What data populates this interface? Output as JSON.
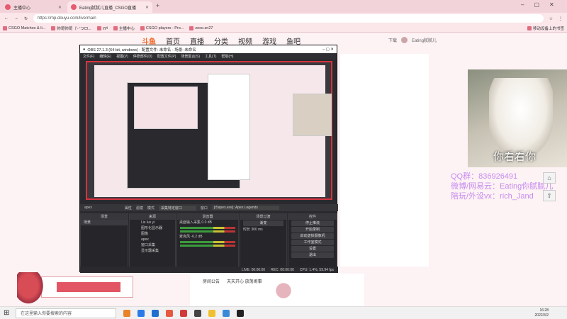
{
  "browser": {
    "tabs": [
      {
        "label": "主播中心"
      },
      {
        "label": "Eating腻腻儿直播_CSGO直播"
      }
    ],
    "url": "https://mp.douyu.com/live/main",
    "bookmarks": [
      "CSGO Matches & li...",
      "帅哥帅哥（'- 'つロ...",
      "yyt",
      "主播中心",
      "CSGO players - Pro...",
      "zoxo.zn27"
    ],
    "bookmark_right": "移动设备上的书签"
  },
  "site": {
    "logo": "斗鱼",
    "nav": [
      "首页",
      "直播",
      "分类",
      "视频",
      "游戏",
      "鱼吧"
    ],
    "user": "Eating腻腻儿",
    "download": "下载"
  },
  "stream": {
    "overlay_caption": "你看看你",
    "qq_line": "QQ群：836926491",
    "weibo_line": "微博/网易云：Eating你腻腻儿",
    "vx_line": "陪玩/外设vx：rich_Jand"
  },
  "obs": {
    "title": "OBS 27.1.3 (64-bit, windows) - 配置文件: 未命名 - 场景: 未命名",
    "menu": [
      "文件(F)",
      "编辑(E)",
      "视图(V)",
      "停靠部件(D)",
      "配置文件(P)",
      "场景集合(S)",
      "工具(T)",
      "帮助(H)"
    ],
    "source_bar": {
      "source": "apex",
      "props": "属性",
      "filters": "滤镜",
      "mode_label": "模式",
      "mode_value": "采集特定窗口",
      "window_label": "窗口",
      "window_value": "[r5apex.exe]: Apex Legends"
    },
    "docks": {
      "scenes": {
        "header": "场景",
        "items": [
          "场景"
        ]
      },
      "sources": {
        "header": "来源",
        "items": [
          "Lis lus yi",
          "图形化显示器",
          "图像",
          "apex",
          "窗口采集",
          "显示器采集"
        ]
      },
      "mixer": {
        "header": "混音器",
        "items": [
          {
            "name": "桌面输入采集",
            "db": "0.0 dB"
          },
          {
            "name": "麦克风",
            "db": "-6.2 dB"
          }
        ]
      },
      "transitions": {
        "header": "场景过渡",
        "type": "渐变",
        "duration_label": "时长",
        "duration": "300 ms"
      },
      "controls": {
        "header": "控件",
        "buttons": [
          "停止推流",
          "开始录制",
          "启动虚拟摄像机",
          "工作室模式",
          "设置",
          "退出"
        ]
      }
    },
    "status": {
      "live": "LIVE: 00:00:00",
      "rec": "REC: 00:00:00",
      "cpu": "CPU: 1.4%, 59.94 fps"
    }
  },
  "notice": {
    "label": "房间公告",
    "text": "天天开心 放荡闹事"
  },
  "taskbar": {
    "search_placeholder": "在这里输入你要搜索的内容",
    "time": "16:28",
    "date": "2022/3/2"
  }
}
